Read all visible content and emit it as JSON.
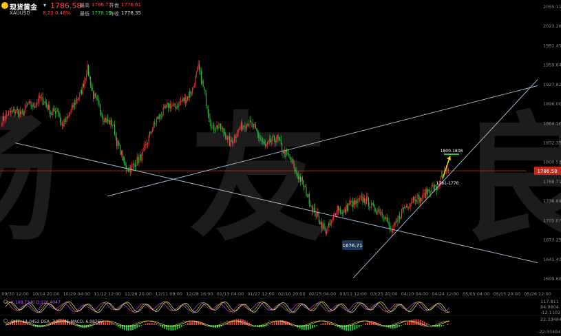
{
  "header": {
    "symbol": "现货黄金",
    "code": "XAUUSD",
    "price": "1786.58",
    "change": "8.23",
    "change_pct": "0.46%",
    "high_label": "最高",
    "high": "1786.77",
    "open_label": "开盘",
    "open": "1776.61",
    "low_label": "最低",
    "low": "1778.15",
    "prev_label": "昨收",
    "prev": "1778.35",
    "colors": {
      "up": "#ff4a4a",
      "down": "#2ecc40",
      "logo": "#f2c500"
    }
  },
  "chart_data": {
    "type": "candlestick",
    "x_ticks": [
      "09/30 12:00",
      "10/14 20:00",
      "10/29 04:00",
      "11/12 12:00",
      "11/26 20:00",
      "12/11 08:00",
      "12/28 16:00",
      "01/13 04:00",
      "01/27 12:00",
      "02/10 20:00",
      "02/25 04:00",
      "03/11 12:00",
      "03/25 20:00",
      "04/10 04:00",
      "04/24 12:00",
      "05/05 04:00",
      "05/15 20:00",
      "05/26 12:00"
    ],
    "y_ticks": [
      "2055.11",
      "2023.28",
      "1991.45",
      "1959.64",
      "1927.82",
      "1896.00",
      "1864.16",
      "1832.35",
      "1800.53",
      "1768.71",
      "1736.89",
      "1705.07",
      "1673.25",
      "1641.43",
      "1609.60"
    ],
    "ylim": [
      1609.6,
      2055.11
    ],
    "current_price": "1786.58",
    "close_path": [
      [
        0,
        1868
      ],
      [
        3,
        1880
      ],
      [
        7,
        1885
      ],
      [
        10,
        1878
      ],
      [
        13,
        1895
      ],
      [
        16,
        1893
      ],
      [
        19,
        1905
      ],
      [
        22,
        1898
      ],
      [
        25,
        1880
      ],
      [
        28,
        1888
      ],
      [
        30,
        1860
      ],
      [
        33,
        1872
      ],
      [
        37,
        1900
      ],
      [
        40,
        1915
      ],
      [
        43,
        1955
      ],
      [
        46,
        1910
      ],
      [
        49,
        1892
      ],
      [
        51,
        1875
      ],
      [
        53,
        1868
      ],
      [
        56,
        1863
      ],
      [
        58,
        1832
      ],
      [
        60,
        1818
      ],
      [
        62,
        1793
      ],
      [
        65,
        1790
      ],
      [
        68,
        1803
      ],
      [
        71,
        1812
      ],
      [
        75,
        1850
      ],
      [
        78,
        1870
      ],
      [
        81,
        1882
      ],
      [
        84,
        1895
      ],
      [
        87,
        1890
      ],
      [
        90,
        1900
      ],
      [
        93,
        1905
      ],
      [
        96,
        1920
      ],
      [
        99,
        1956
      ],
      [
        101,
        1930
      ],
      [
        103,
        1900
      ],
      [
        106,
        1855
      ],
      [
        109,
        1860
      ],
      [
        112,
        1850
      ],
      [
        115,
        1830
      ],
      [
        118,
        1847
      ],
      [
        121,
        1860
      ],
      [
        124,
        1866
      ],
      [
        127,
        1858
      ],
      [
        130,
        1840
      ],
      [
        133,
        1825
      ],
      [
        136,
        1837
      ],
      [
        139,
        1840
      ],
      [
        142,
        1816
      ],
      [
        145,
        1810
      ],
      [
        148,
        1785
      ],
      [
        151,
        1770
      ],
      [
        154,
        1746
      ],
      [
        157,
        1722
      ],
      [
        160,
        1706
      ],
      [
        163,
        1688
      ],
      [
        166,
        1700
      ],
      [
        169,
        1728
      ],
      [
        172,
        1716
      ],
      [
        175,
        1733
      ],
      [
        178,
        1732
      ],
      [
        181,
        1740
      ],
      [
        184,
        1738
      ],
      [
        187,
        1725
      ],
      [
        190,
        1722
      ],
      [
        193,
        1715
      ],
      [
        196,
        1685
      ],
      [
        199,
        1700
      ],
      [
        202,
        1725
      ],
      [
        205,
        1732
      ],
      [
        208,
        1745
      ],
      [
        211,
        1738
      ],
      [
        214,
        1752
      ],
      [
        217,
        1760
      ],
      [
        219,
        1756
      ],
      [
        221,
        1772
      ],
      [
        223,
        1782
      ],
      [
        225,
        1786
      ]
    ],
    "trendlines": [
      {
        "from": [
          "09/30 12:00",
          1832.3
        ],
        "to": [
          "05/26 12:00",
          1636.0
        ]
      },
      {
        "from": [
          "11/12 12:00",
          1745.0
        ],
        "to": [
          "05/26 12:00",
          1926.0
        ]
      },
      {
        "from": [
          "03/11 12:00",
          1611.0
        ],
        "to": [
          "05/26 12:00",
          1936.0
        ]
      }
    ],
    "annotations": [
      {
        "text": "1676.71",
        "type": "low-label"
      },
      {
        "text": "1800-1808",
        "type": "target"
      },
      {
        "text": "1781-1776",
        "type": "support"
      }
    ],
    "indicators": {
      "kdj": {
        "legend": "K:108.7340  D:120.4047",
        "ticks": [
          "117.811",
          "84.9804",
          "-12.1102"
        ],
        "colors": [
          "#ffffff",
          "#ffd700",
          "#d05cff"
        ]
      },
      "macd": {
        "legend": "DIFF: 11.0452  DEA: 7.27405  MACD: 6.98765",
        "ticks": [
          "22.33484",
          "-22.33484"
        ],
        "colors": [
          "#ffffff",
          "#ffd700",
          "#ff3b3b",
          "#2ecc40"
        ]
      }
    },
    "watermark_text": "汤 友 良",
    "grid": false
  }
}
